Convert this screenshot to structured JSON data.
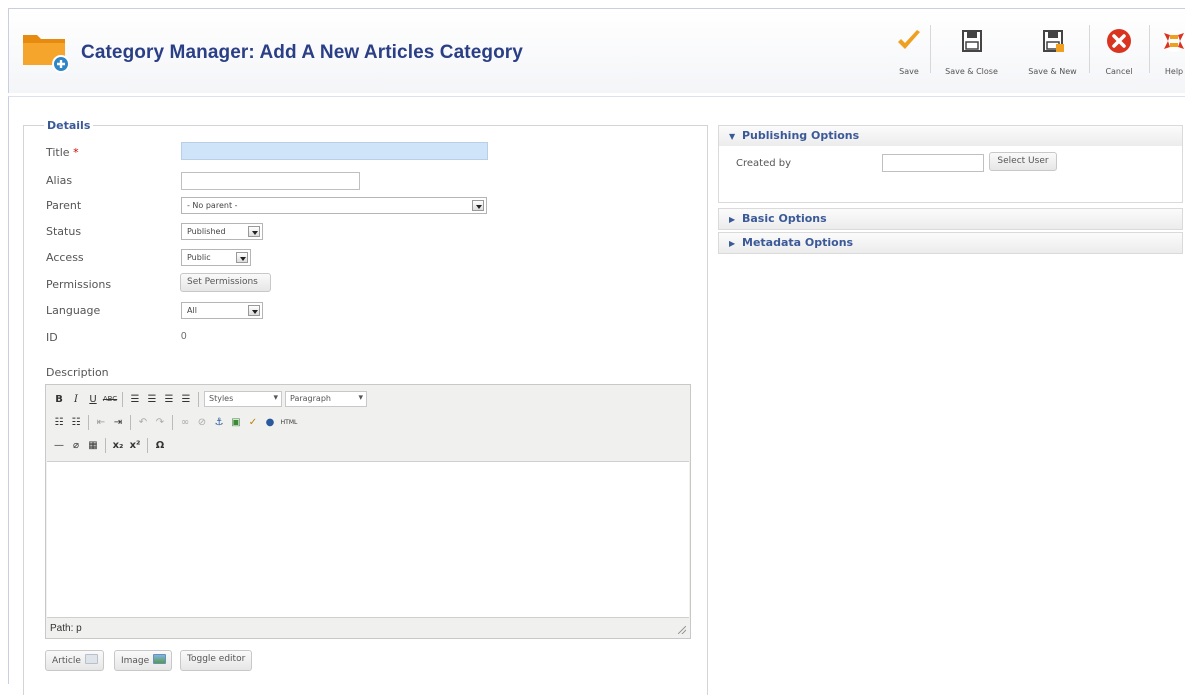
{
  "header": {
    "title": "Category Manager: Add A New Articles Category",
    "toolbar": {
      "save": "Save",
      "save_close": "Save & Close",
      "save_new": "Save & New",
      "cancel": "Cancel",
      "help": "Help"
    }
  },
  "details": {
    "legend": "Details",
    "fields": {
      "title_label": "Title",
      "title_required": " *",
      "title_value": "",
      "alias_label": "Alias",
      "alias_value": "",
      "parent_label": "Parent",
      "parent_value": "- No parent -",
      "status_label": "Status",
      "status_value": "Published",
      "access_label": "Access",
      "access_value": "Public",
      "permissions_label": "Permissions",
      "permissions_button": "Set Permissions",
      "language_label": "Language",
      "language_value": "All",
      "id_label": "ID",
      "id_value": "0",
      "description_label": "Description"
    },
    "editor": {
      "styles_select": "Styles",
      "format_select": "Paragraph",
      "path": "Path: p",
      "buttons": {
        "article": "Article",
        "image": "Image",
        "toggle": "Toggle editor"
      }
    }
  },
  "right": {
    "publishing": {
      "title": "Publishing Options",
      "created_by_label": "Created by",
      "created_by_value": "",
      "select_user_button": "Select User"
    },
    "basic": {
      "title": "Basic Options"
    },
    "metadata": {
      "title": "Metadata Options"
    }
  },
  "colors": {
    "title_blue": "#2a3f86",
    "section_blue": "#3b5998",
    "title_field_bg": "#cfe3f9",
    "save_check": "#f0a020",
    "cancel_red": "#d9341f"
  },
  "icons": {
    "header": "category-folder-add-icon",
    "save": "checkmark-icon",
    "save_close": "floppy-disk-icon",
    "save_new": "floppy-disk-new-icon",
    "cancel": "cancel-x-icon",
    "help": "lifebuoy-help-icon"
  }
}
